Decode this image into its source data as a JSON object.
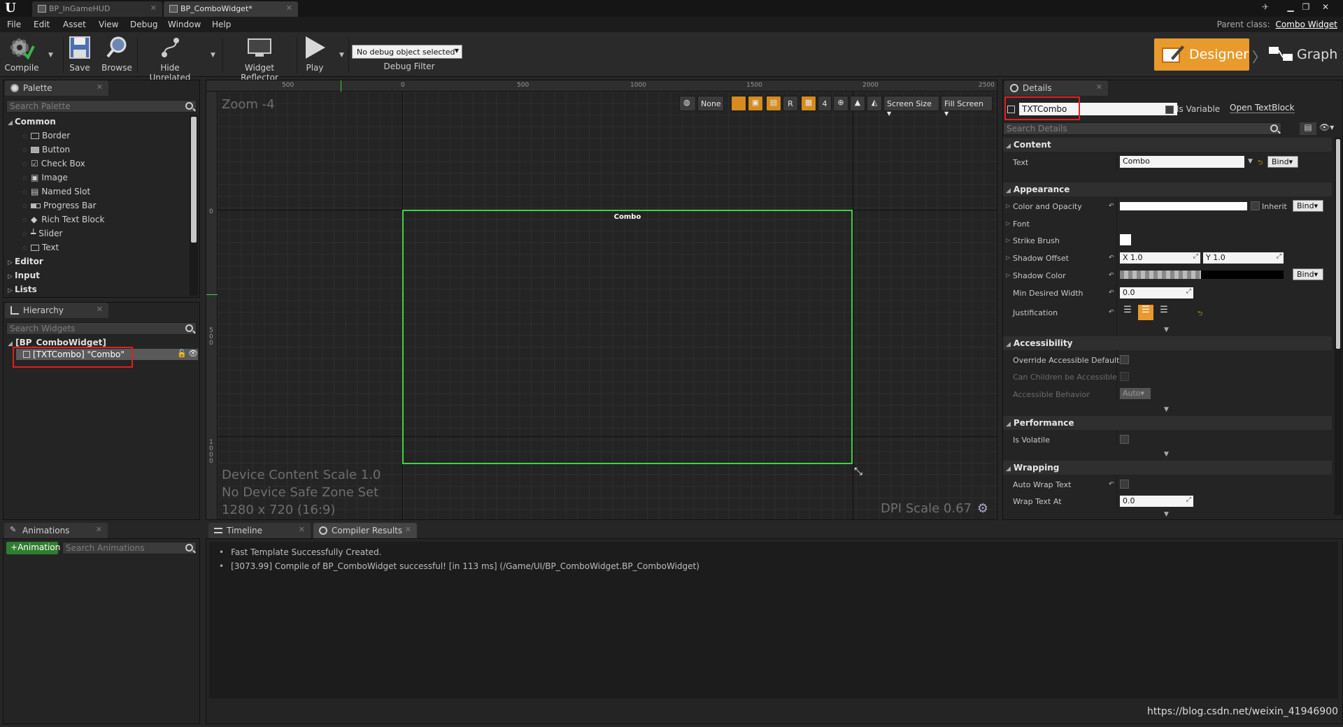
{
  "tabs": [
    {
      "label": "BP_InGameHUD",
      "active": false
    },
    {
      "label": "BP_ComboWidget*",
      "active": true
    }
  ],
  "menu": [
    "File",
    "Edit",
    "Asset",
    "View",
    "Debug",
    "Window",
    "Help"
  ],
  "parent_class": {
    "label": "Parent class:",
    "value": "Combo Widget"
  },
  "toolbar": {
    "compile": "Compile",
    "save": "Save",
    "browse": "Browse",
    "hide_unrelated": "Hide Unrelated",
    "widget_reflector": "Widget Reflector",
    "play": "Play",
    "debug_object": "No debug object selected",
    "debug_filter": "Debug Filter",
    "designer": "Designer",
    "graph": "Graph"
  },
  "palette": {
    "title": "Palette",
    "search_placeholder": "Search Palette",
    "common": "Common",
    "items": [
      "Border",
      "Button",
      "Check Box",
      "Image",
      "Named Slot",
      "Progress Bar",
      "Rich Text Block",
      "Slider",
      "Text"
    ],
    "categories": [
      "Editor",
      "Input",
      "Lists"
    ]
  },
  "hierarchy": {
    "title": "Hierarchy",
    "search_placeholder": "Search Widgets",
    "root": "[BP_ComboWidget]",
    "child": "[TXTCombo] \"Combo\""
  },
  "canvas": {
    "zoom": "Zoom -4",
    "ruler_top": [
      "500",
      "0",
      "500",
      "1000",
      "1500",
      "2000",
      "2500"
    ],
    "ruler_left_zero": "0",
    "ruler_left_500": "5\n0\n0",
    "ruler_left_1000": "1\n0\n0\n0",
    "widget_text": "Combo",
    "device_lines": [
      "Device Content Scale 1.0",
      "No Device Safe Zone Set",
      "1280 x 720 (16:9)"
    ],
    "dpi": "DPI Scale 0.67",
    "toolbar": {
      "none": "None",
      "r": "R",
      "grid_value": "4",
      "screen_size": "Screen Size",
      "fill_screen": "Fill Screen"
    }
  },
  "details": {
    "title": "Details",
    "name": "TXTCombo",
    "is_variable": "Is Variable",
    "open_textblock": "Open TextBlock",
    "search_placeholder": "Search Details",
    "bind": "Bind",
    "sections": {
      "content": "Content",
      "appearance": "Appearance",
      "accessibility": "Accessibility",
      "performance": "Performance",
      "wrapping": "Wrapping"
    },
    "props": {
      "text_label": "Text",
      "text_value": "Combo",
      "color_opacity": "Color and Opacity",
      "inherit": "Inherit",
      "font": "Font",
      "strike_brush": "Strike Brush",
      "shadow_offset": "Shadow Offset",
      "shadow_x": "X  1.0",
      "shadow_y": "Y  1.0",
      "shadow_color": "Shadow Color",
      "min_desired_width": "Min Desired Width",
      "min_desired_width_value": "0.0",
      "justification": "Justification",
      "override_accessible": "Override Accessible Defaults",
      "children_accessible": "Can Children be Accessible",
      "accessible_behavior": "Accessible Behavior",
      "accessible_behavior_value": "Auto",
      "is_volatile": "Is Volatile",
      "auto_wrap": "Auto Wrap Text",
      "wrap_text_at": "Wrap Text At",
      "wrap_text_at_value": "0.0"
    }
  },
  "animations": {
    "title": "Animations",
    "add_button": "Animation",
    "search_placeholder": "Search Animations"
  },
  "bottom_tabs": [
    "Timeline",
    "Compiler Results"
  ],
  "log": [
    "Fast Template Successfully Created.",
    "[3073.99] Compile of BP_ComboWidget successful! [in 113 ms] (/Game/UI/BP_ComboWidget.BP_ComboWidget)"
  ],
  "watermark": "https://blog.csdn.net/weixin_41946900",
  "colors": {
    "accent": "#e89a2c",
    "selection_outline": "#3fd23f",
    "highlight_box": "#e02020"
  }
}
